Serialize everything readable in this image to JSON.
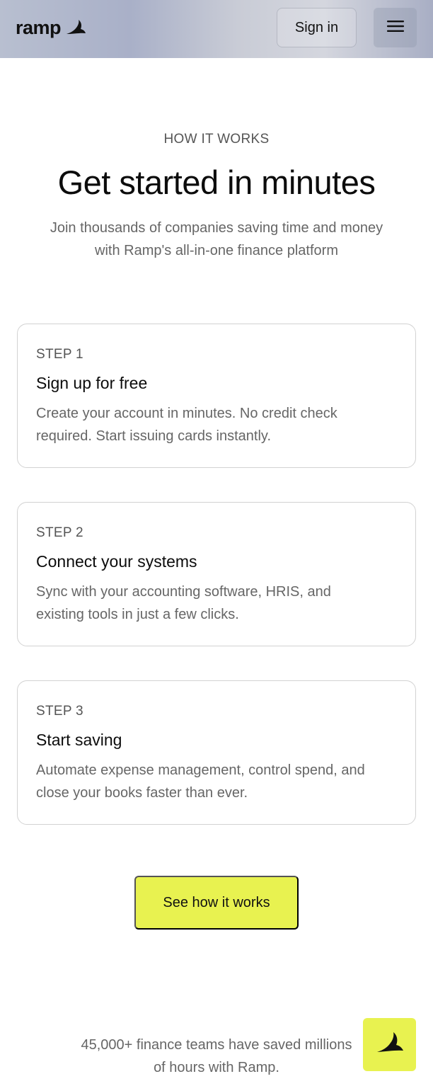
{
  "header": {
    "logo_text": "ramp",
    "signin_label": "Sign in"
  },
  "section": {
    "eyebrow": "HOW IT WORKS",
    "title": "Get started in minutes",
    "subtitle": "Join thousands of companies saving time and money with Ramp's all-in-one finance platform"
  },
  "steps": [
    {
      "label": "STEP 1",
      "title": "Sign up for free",
      "description": "Create your account in minutes. No credit check required. Start issuing cards instantly."
    },
    {
      "label": "STEP 2",
      "title": "Connect your systems",
      "description": "Sync with your accounting software, HRIS, and existing tools in just a few clicks."
    },
    {
      "label": "STEP 3",
      "title": "Start saving",
      "description": "Automate expense management, control spend, and close your books faster than ever."
    }
  ],
  "cta": {
    "label": "See how it works"
  },
  "footer": {
    "text": "45,000+ finance teams have saved millions of hours with Ramp."
  },
  "colors": {
    "accent": "#e8f250",
    "text_primary": "#0c0c0c",
    "text_muted": "#666666"
  },
  "icons": {
    "logo": "ramp-logo-icon",
    "menu": "hamburger-menu-icon",
    "fab": "ramp-mark-icon"
  }
}
